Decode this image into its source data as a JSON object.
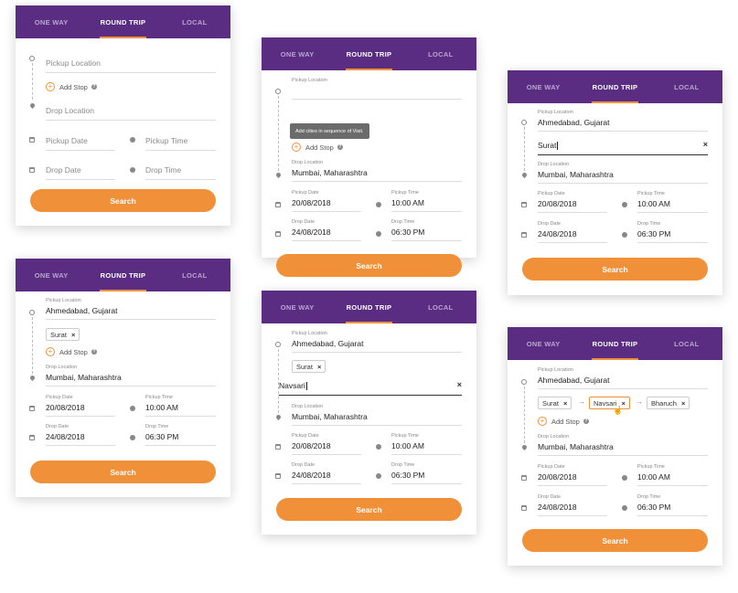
{
  "tabs": [
    "ONE WAY",
    "ROUND TRIP",
    "LOCAL"
  ],
  "labels": {
    "pickup_location": "Pickup Location",
    "drop_location": "Drop Location",
    "add_stop": "Add Stop",
    "pickup_date": "Pickup Date",
    "pickup_time": "Pickup Time",
    "drop_date": "Drop Date",
    "drop_time": "Drop Time",
    "search": "Search"
  },
  "values": {
    "pickup_location": "Ahmedabad, Gujarat",
    "drop_location": "Mumbai, Maharashtra",
    "pickup_date": "20/08/2018",
    "pickup_time": "10:00 AM",
    "drop_date": "24/08/2018",
    "drop_time": "06:30 PM"
  },
  "stops": {
    "surat": "Surat",
    "navsari": "Navsari",
    "bharuch": "Bharuch"
  },
  "tooltip": "Add cities in sequence of Visit.",
  "icons": {
    "remove": "×",
    "help": "?",
    "plus": "+",
    "arrow": "→",
    "cursor": "☝"
  },
  "colors": {
    "header": "#5a2d82",
    "accent": "#f0913a"
  }
}
